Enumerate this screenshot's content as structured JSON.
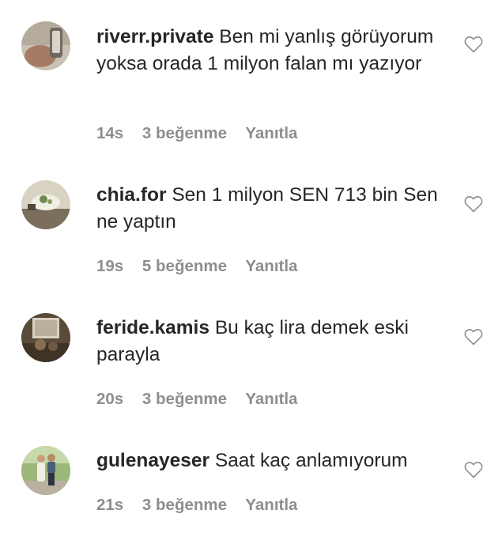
{
  "comments": [
    {
      "username": "riverr.private",
      "text": "Ben mi yanlış görüyorum yoksa orada 1 milyon falan mı yazıyor",
      "time": "14s",
      "likes": "3 beğenme",
      "reply": "Yanıtla",
      "avatar_icon": "avatar-photo-hand"
    },
    {
      "username": "chia.for",
      "text": "Sen 1 milyon SEN 713 bin Sen ne yaptın",
      "time": "19s",
      "likes": "5 beğenme",
      "reply": "Yanıtla",
      "avatar_icon": "avatar-photo-table"
    },
    {
      "username": "feride.kamis",
      "text": "Bu kaç lira demek eski parayla",
      "time": "20s",
      "likes": "3 beğenme",
      "reply": "Yanıtla",
      "avatar_icon": "avatar-photo-room"
    },
    {
      "username": "gulenayeser",
      "text": "Saat kaç anlamıyorum",
      "time": "21s",
      "likes": "3 beğenme",
      "reply": "Yanıtla",
      "avatar_icon": "avatar-photo-couple"
    }
  ],
  "colors": {
    "text": "#262626",
    "meta": "#8e8e8e",
    "heart_outline": "#8e8e8e"
  }
}
